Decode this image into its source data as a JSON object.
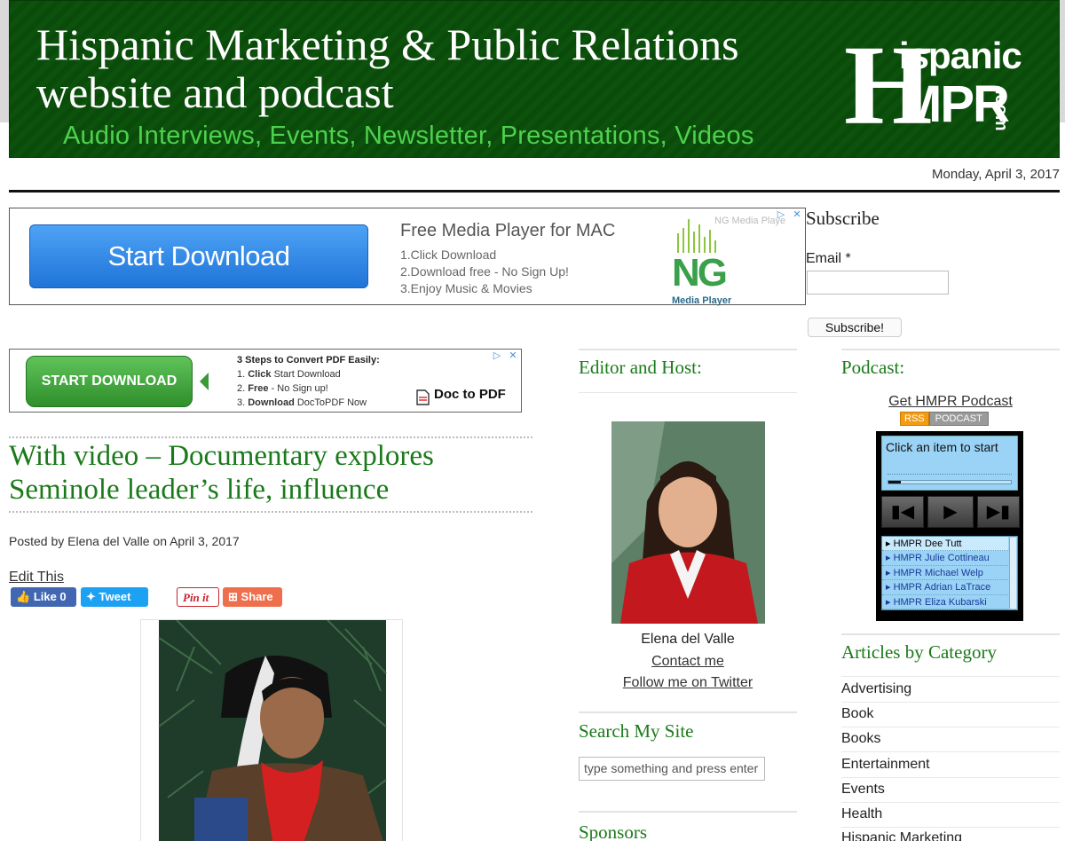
{
  "header": {
    "title": "Hispanic Marketing & Public Relations website and podcast",
    "subtitle": "Audio Interviews, Events, Newsletter, Presentations, Videos",
    "logo_h": "H",
    "logo_ispanic": "ispanic",
    "logo_mpr": "MPR",
    "logo_com": ".com"
  },
  "date": "Monday, April 3, 2017",
  "ad_top": {
    "button": "Start Download",
    "heading": "Free Media Player for MAC",
    "lines": [
      "1.Click Download",
      "2.Download free - No Sign Up!",
      "3.Enjoy Music & Movies"
    ],
    "logo_text": "NG",
    "logo_sub": "Media Player",
    "corner_text": "NG Media Playe"
  },
  "subscribe": {
    "title": "Subscribe",
    "email_label": "Email *",
    "email_value": "",
    "button": "Subscribe!"
  },
  "ad_second": {
    "button": "START DOWNLOAD",
    "heading": "3 Steps to Convert PDF Easily:",
    "lines": [
      {
        "bold": "Click",
        "rest": " Start Download",
        "num": "1. "
      },
      {
        "bold": "Free",
        "rest": " - No Sign up!",
        "num": "2. "
      },
      {
        "bold": "Download",
        "rest": " DocToPDF Now",
        "num": "3. "
      }
    ],
    "brand": "Doc to PDF"
  },
  "article": {
    "title": "With video – Documentary explores Seminole leader’s life, influence",
    "posted": "Posted by Elena del Valle on April 3, 2017",
    "edit": "Edit This",
    "social": {
      "like": "Like 0",
      "tweet": "Tweet",
      "pin": "Pin it",
      "share": "Share"
    }
  },
  "editor": {
    "heading": "Editor and Host:",
    "name": "Elena del Valle",
    "contact": "Contact me",
    "twitter": "Follow me on Twitter"
  },
  "search": {
    "heading": "Search My Site",
    "placeholder": "type something and press enter"
  },
  "sponsors": {
    "heading": "Sponsors"
  },
  "podcast": {
    "heading": "Podcast:",
    "link": "Get HMPR Podcast",
    "rss": "RSS",
    "rss_podcast": "PODCAST",
    "screen_text": "Click an item to start",
    "progress": 0.1,
    "items": [
      "HMPR Dee Tutt",
      "HMPR Julie Cottineau",
      "HMPR Michael Welp",
      "HMPR Adrian LaTrace",
      "HMPR Eliza Kubarski"
    ]
  },
  "categories": {
    "heading": "Articles by Category",
    "items": [
      "Advertising",
      "Book",
      "Books",
      "Entertainment",
      "Events",
      "Health",
      "Hispanic Marketing"
    ]
  },
  "colors": {
    "banner_green": "#0a4a0a",
    "subtitle_green": "#4fd14f",
    "heading_green": "#1a7a1a"
  }
}
